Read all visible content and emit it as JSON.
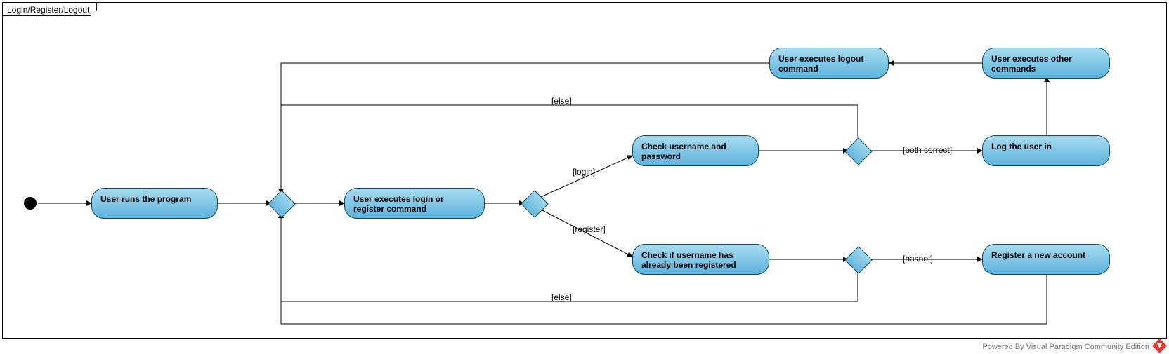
{
  "frame": {
    "title": "Login/Register/Logout"
  },
  "nodes": {
    "a_run": "User runs the program",
    "a_exec": "User executes login or register command",
    "a_checkpw": "Check username and password",
    "a_checkreg": "Check if username has already been registered",
    "a_logout": "User executes logout command",
    "a_other": "User executes other commands",
    "a_login": "Log the user in",
    "a_register": "Register a new account"
  },
  "guards": {
    "g_login": "[login]",
    "g_register": "[register]",
    "g_else1": "[else]",
    "g_else2": "[else]",
    "g_bothcorrect": "[both correct]",
    "g_hasnot": "[hasnot]"
  },
  "watermark": "Powered By   Visual Paradigm Community Edition",
  "chart_data": {
    "type": "uml-activity-diagram",
    "title": "Login/Register/Logout",
    "initial": "start",
    "activities": [
      {
        "id": "a_run",
        "label": "User runs the program"
      },
      {
        "id": "a_exec",
        "label": "User executes login or register command"
      },
      {
        "id": "a_checkpw",
        "label": "Check username and password"
      },
      {
        "id": "a_checkreg",
        "label": "Check if username has already been registered"
      },
      {
        "id": "a_login",
        "label": "Log the user in"
      },
      {
        "id": "a_register",
        "label": "Register a new account"
      },
      {
        "id": "a_other",
        "label": "User executes other commands"
      },
      {
        "id": "a_logout",
        "label": "User executes logout command"
      }
    ],
    "decisions": [
      "merge1",
      "d_cmd",
      "d_pw",
      "d_reg"
    ],
    "edges": [
      {
        "from": "start",
        "to": "a_run"
      },
      {
        "from": "a_run",
        "to": "merge1"
      },
      {
        "from": "merge1",
        "to": "a_exec"
      },
      {
        "from": "a_exec",
        "to": "d_cmd"
      },
      {
        "from": "d_cmd",
        "to": "a_checkpw",
        "guard": "[login]"
      },
      {
        "from": "d_cmd",
        "to": "a_checkreg",
        "guard": "[register]"
      },
      {
        "from": "a_checkpw",
        "to": "d_pw"
      },
      {
        "from": "d_pw",
        "to": "a_login",
        "guard": "[both correct]"
      },
      {
        "from": "d_pw",
        "to": "merge1",
        "guard": "[else]"
      },
      {
        "from": "a_checkreg",
        "to": "d_reg"
      },
      {
        "from": "d_reg",
        "to": "a_register",
        "guard": "[hasnot]"
      },
      {
        "from": "d_reg",
        "to": "merge1",
        "guard": "[else]"
      },
      {
        "from": "a_login",
        "to": "a_other"
      },
      {
        "from": "a_other",
        "to": "a_logout"
      },
      {
        "from": "a_logout",
        "to": "merge1"
      },
      {
        "from": "a_register",
        "to": "merge1"
      }
    ]
  }
}
